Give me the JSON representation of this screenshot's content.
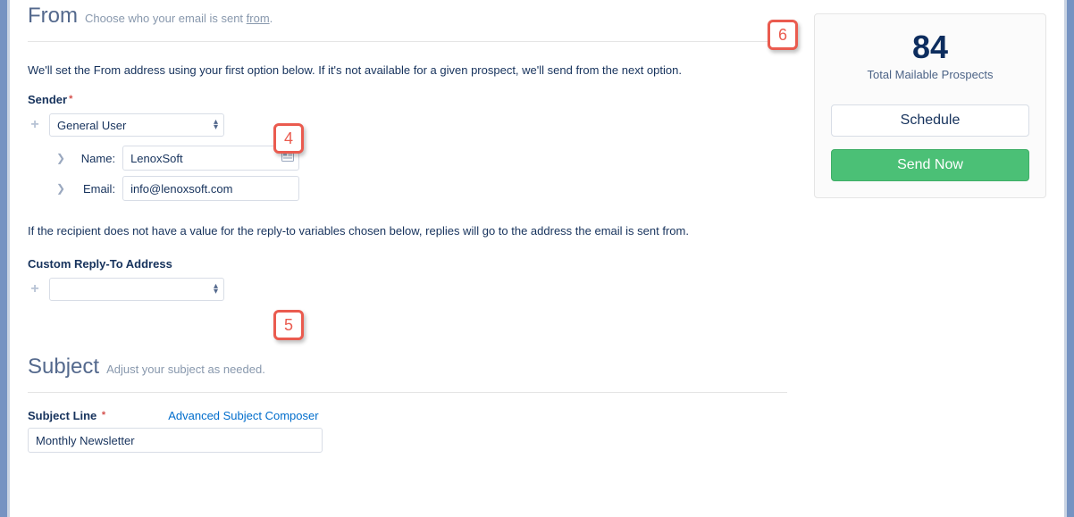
{
  "from": {
    "title": "From",
    "subtitle_pre": "Choose who your email is sent ",
    "subtitle_underlined": "from",
    "subtitle_post": ".",
    "helper": "We'll set the From address using your first option below. If it's not available for a given prospect, we'll send from the next option.",
    "sender_label": "Sender",
    "sender_select": "General User",
    "name_label": "Name:",
    "name_value": "LenoxSoft",
    "email_label": "Email:",
    "email_value": "info@lenoxsoft.com"
  },
  "replyto": {
    "helper": "If the recipient does not have a value for the reply-to variables chosen below, replies will go to the address the email is sent from.",
    "label": "Custom Reply-To Address",
    "select": ""
  },
  "subject": {
    "title": "Subject",
    "subtitle": "Adjust your subject as needed.",
    "label": "Subject Line",
    "composer_link": "Advanced Subject Composer",
    "value": "Monthly Newsletter"
  },
  "right": {
    "count": "84",
    "count_label": "Total Mailable Prospects",
    "schedule": "Schedule",
    "send_now": "Send Now"
  },
  "callouts": {
    "c4": "4",
    "c5": "5",
    "c6": "6"
  }
}
